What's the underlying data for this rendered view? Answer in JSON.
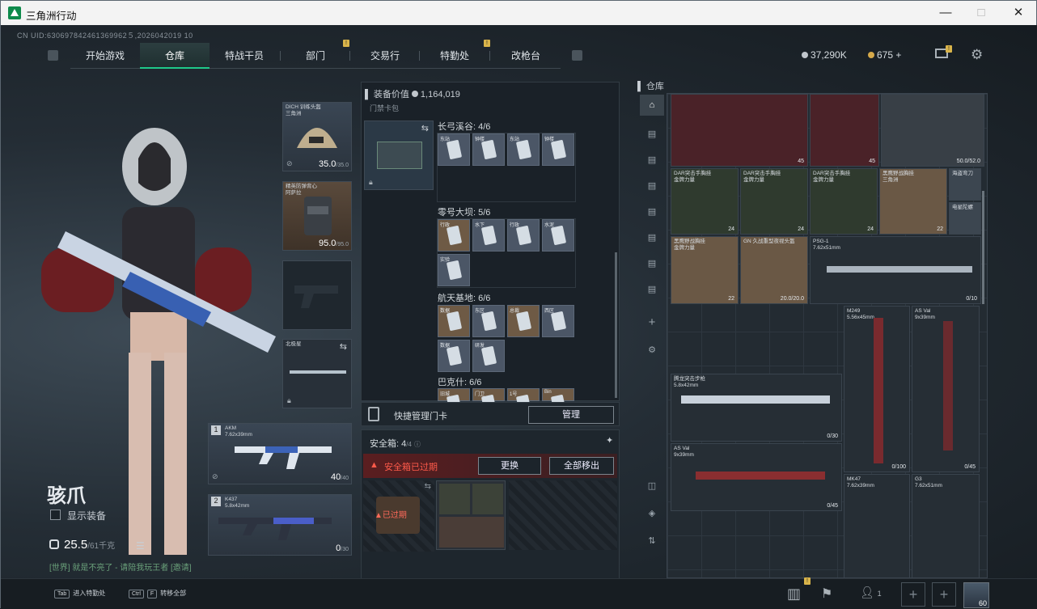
{
  "window": {
    "title": "三角洲行动",
    "min": "—",
    "max": "□",
    "close": "✕"
  },
  "uid": "CN UID:630697842461369962５,2026042019 10",
  "nav": {
    "tabs": [
      "开始游戏",
      "仓库",
      "特战干员",
      "部门",
      "交易行",
      "特勤处",
      "改枪台"
    ],
    "active": 1
  },
  "currency": {
    "silver": "37,290K",
    "gold": "675",
    "plus": "+"
  },
  "operator": {
    "name": "骇爪",
    "show_gear": "显示装备",
    "weight": "25.5",
    "weight_max": "/61千克",
    "chat": "[世界] 就是不亮了 - 请陪我玩王者 [邀请]"
  },
  "gear": {
    "helmet": {
      "label": "DICH 训练头盔\n三角洲",
      "value": "35.0",
      "max": "/35.0"
    },
    "armor": {
      "label": "精英防弹背心\n阿萨拉",
      "value": "95.0",
      "max": "/95.0"
    },
    "melee": {
      "label": "北极星"
    },
    "primary": {
      "index": "1",
      "label": "AKM\n7.62x39mm",
      "value": "40",
      "max": "/40"
    },
    "secondary": {
      "index": "2",
      "label": "K437\n5.8x42mm",
      "value": "0",
      "max": "/30"
    }
  },
  "keys": {
    "equip_value_label": "装备价值",
    "equip_value": "1,164,019",
    "card_pack": "门禁卡包",
    "maps": [
      {
        "name": "长弓溪谷: 4/6",
        "cards": [
          "东站",
          "钟楼",
          "东站",
          "钟楼"
        ]
      },
      {
        "name": "零号大坝: 5/6",
        "cards": [
          "行政",
          "水下",
          "行政",
          "水泥",
          "实验"
        ]
      },
      {
        "name": "航天基地: 6/6",
        "cards": [
          "数据",
          "东区",
          "总裁",
          "西区",
          "数据",
          "研发"
        ]
      },
      {
        "name": "巴克什: 6/6",
        "cards": [
          "旧城",
          "门卫",
          "1号",
          "Bin"
        ]
      }
    ],
    "quick_manage": "快捷管理门卡",
    "manage_btn": "管理"
  },
  "safe": {
    "title": "安全箱: 4",
    "cap": "/4",
    "expired": "安全箱已过期",
    "replace": "更换",
    "move_all": "全部移出",
    "expired_tag": "已过期"
  },
  "storage": {
    "title": "仓库",
    "items": [
      {
        "label": "",
        "count": "45"
      },
      {
        "label": "",
        "count": "45"
      },
      {
        "label": "",
        "count": "50.0/52.0"
      },
      {
        "label": "DAR突击手胸挂\n金牌力量",
        "count": "24"
      },
      {
        "label": "DAR突击手胸挂\n金牌力量",
        "count": "24"
      },
      {
        "label": "DAR突击手胸挂\n金牌力量",
        "count": "24"
      },
      {
        "label": "黑鹰野战胸挂\n三角洲",
        "count": "22"
      },
      {
        "label": "海盗弯刀",
        "count": ""
      },
      {
        "label": "电星陀螺",
        "count": ""
      },
      {
        "label": "黑鹰野战胸挂\n金牌力量",
        "count": "22"
      },
      {
        "label": "GN 久战重型夜视头盔",
        "count": "20.0/20.0"
      },
      {
        "label": "PSG-1\n7.62x51mm",
        "count": "0/10"
      },
      {
        "label": "M249\n5.56x45mm",
        "count": "0/100"
      },
      {
        "label": "AS Val\n9x39mm",
        "count": "0/45"
      },
      {
        "label": "腾龙突击步枪\n5.8x42mm",
        "count": "0/30"
      },
      {
        "label": "AS Val\n9x39mm",
        "count": "0/45"
      },
      {
        "label": "MK47\n7.62x39mm",
        "count": ""
      },
      {
        "label": "G3\n7.62x51mm",
        "count": ""
      }
    ]
  },
  "bottom": {
    "tab_key": "Tab",
    "tab_text": "进入特勤处",
    "ctrl_key": "Ctrl",
    "f_key": "F",
    "ctrl_text": "转移全部",
    "friends": "1",
    "level": "60"
  },
  "colors": {
    "accent": "#1fc98a",
    "alert": "#d33a3a",
    "badge": "#d9b44a"
  }
}
